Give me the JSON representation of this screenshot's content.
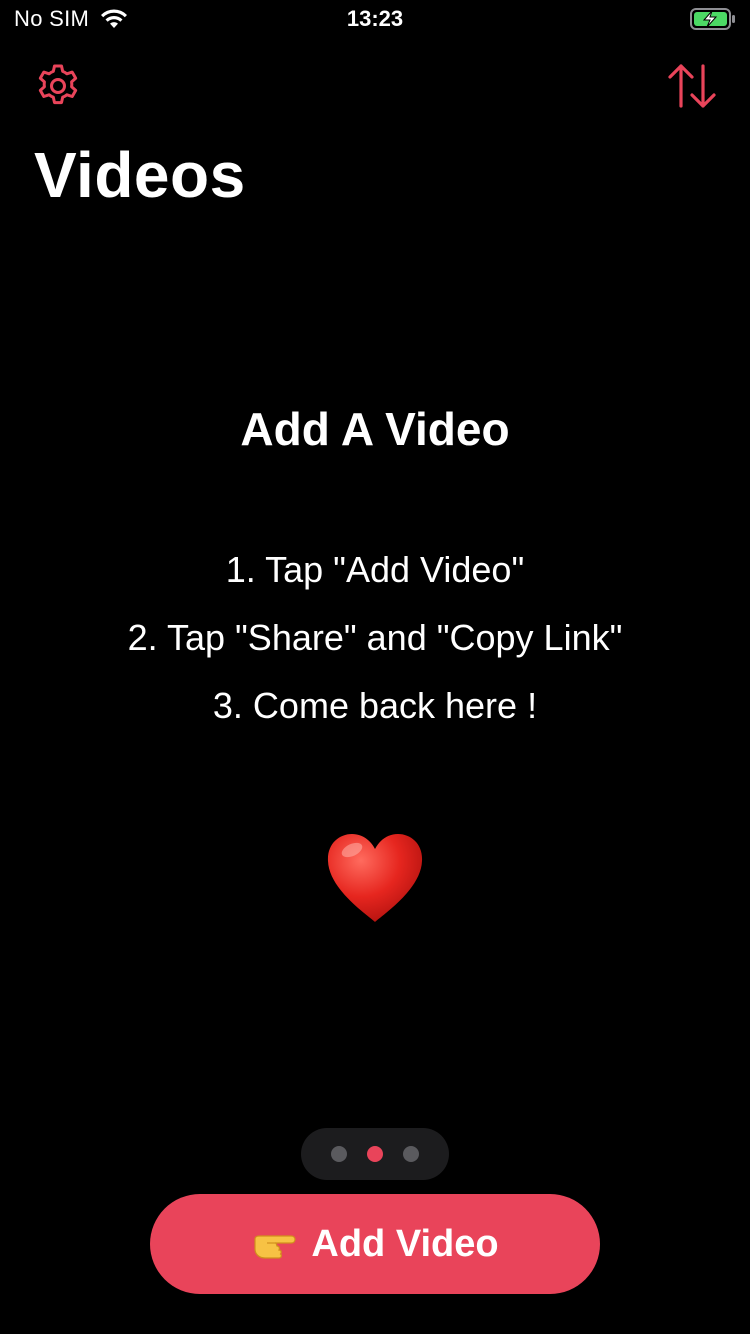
{
  "status_bar": {
    "carrier": "No SIM",
    "time": "13:23",
    "battery_color": "#4cd964"
  },
  "nav": {
    "settings_icon": "gear-icon",
    "sort_icon": "sort-arrows-icon",
    "accent_color": "#e9445a"
  },
  "page": {
    "title": "Videos"
  },
  "empty_state": {
    "heading": "Add A Video",
    "steps": [
      "1. Tap \"Add Video\"",
      "2. Tap \"Share\" and \"Copy Link\"",
      "3. Come back here !"
    ],
    "emoji": "heart-icon"
  },
  "pager": {
    "page_count": 3,
    "current_page": 2
  },
  "primary_button": {
    "icon": "pointing-hand-icon",
    "label": "Add Video",
    "color": "#e9445a"
  }
}
